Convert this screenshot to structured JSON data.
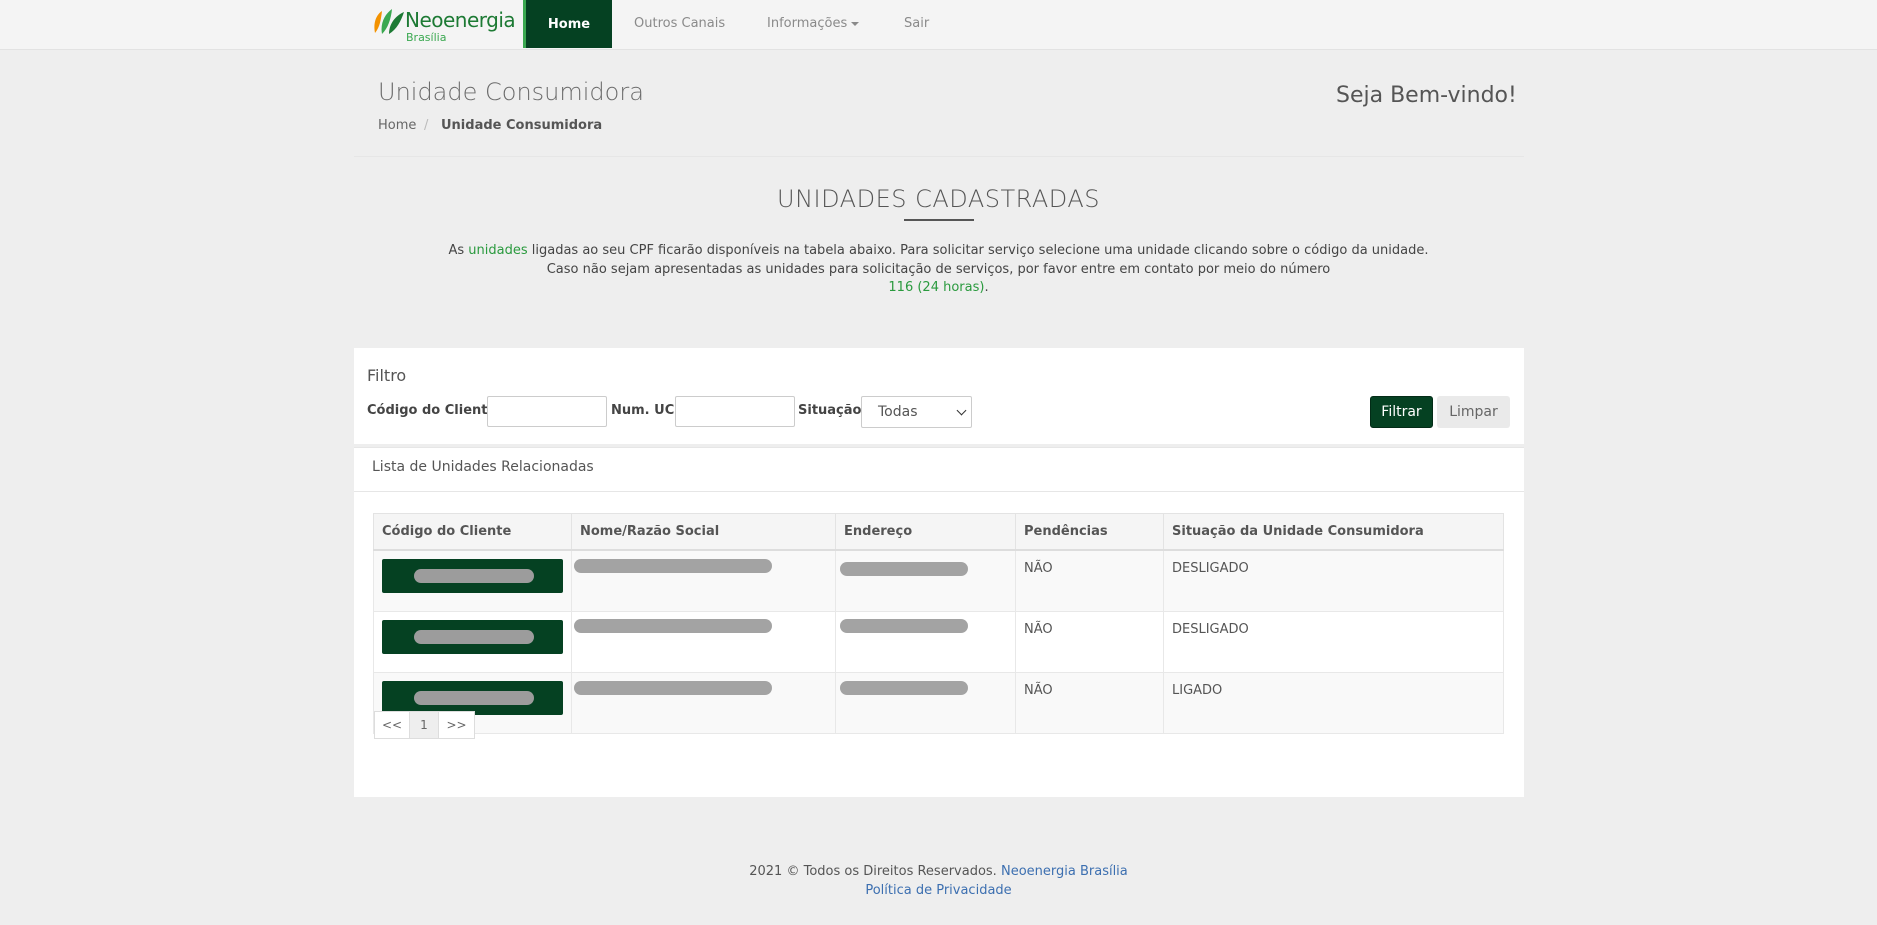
{
  "brand": {
    "name": "Neoenergia",
    "subname": "Brasília"
  },
  "nav": {
    "home": "Home",
    "other_channels": "Outros Canais",
    "info": "Informações",
    "logout": "Sair"
  },
  "header": {
    "title": "Unidade Consumidora",
    "welcome": "Seja Bem-vindo!",
    "breadcrumb": [
      "Home",
      "Unidade Consumidora"
    ],
    "breadcrumb_sep": "/"
  },
  "section": {
    "title": "UNIDADES CADASTRADAS",
    "line1_pre": "As ",
    "line1_link": "unidades",
    "line1_post": " ligadas ao seu CPF ficarão disponíveis na tabela abaixo. Para solicitar serviço selecione uma unidade clicando sobre o código da unidade.",
    "line2": "Caso não sejam apresentadas as unidades para solicitação de serviços, por favor entre em contato por meio do número",
    "phone": "116 (24 horas)",
    "phone_suffix": "."
  },
  "filter": {
    "title": "Filtro",
    "client_code_label": "Código do Cliente:",
    "uc_label": "Num. UC:",
    "status_label": "Situação:",
    "status_selected": "Todas",
    "filter_button": "Filtrar",
    "clear_button": "Limpar"
  },
  "list": {
    "title": "Lista de Unidades Relacionadas",
    "columns": [
      "Código do Cliente",
      "Nome/Razão Social",
      "Endereço",
      "Pendências",
      "Situação da Unidade Consumidora"
    ],
    "rows": [
      {
        "pending": "NÃO",
        "status": "DESLIGADO"
      },
      {
        "pending": "NÃO",
        "status": "DESLIGADO"
      },
      {
        "pending": "NÃO",
        "status": "LIGADO"
      }
    ]
  },
  "pagination": {
    "prev": "<<",
    "page": "1",
    "next": ">>"
  },
  "footer": {
    "copyright": "2021 © Todos os Direitos Reservados.",
    "company_link": "Neoenergia Brasília",
    "privacy_link": "Política de Privacidade"
  },
  "colors": {
    "primary": "#054122",
    "accent": "#3aa850",
    "link": "#3c6fb0"
  }
}
